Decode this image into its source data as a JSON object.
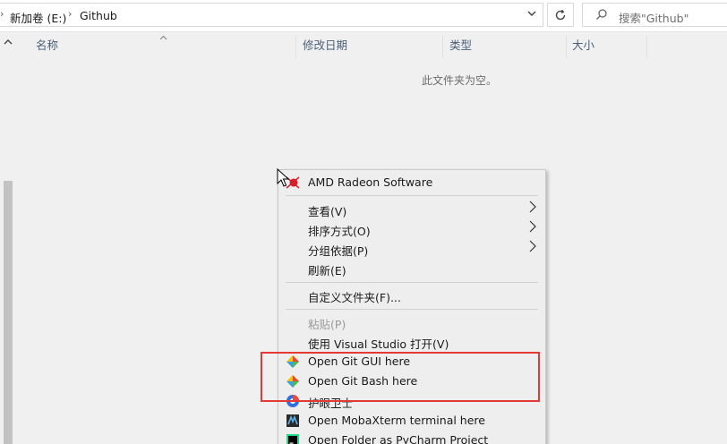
{
  "address": {
    "crumbs": [
      "新加卷 (E:)",
      "Github"
    ]
  },
  "search": {
    "placeholder": "搜索\"Github\""
  },
  "columns": [
    "名称",
    "修改日期",
    "类型",
    "大小"
  ],
  "empty_message": "此文件夹为空。",
  "context_menu": {
    "items": [
      {
        "label": "AMD Radeon Software",
        "icon": "amd-radeon-icon"
      },
      {
        "label": "查看(V)",
        "submenu": true
      },
      {
        "label": "排序方式(O)",
        "submenu": true
      },
      {
        "label": "分组依据(P)",
        "submenu": true
      },
      {
        "label": "刷新(E)"
      },
      {
        "label": "自定义文件夹(F)..."
      },
      {
        "label": "粘贴(P)",
        "disabled": true
      },
      {
        "label": "使用 Visual Studio 打开(V)"
      },
      {
        "label": "Open Git GUI here",
        "icon": "git-icon"
      },
      {
        "label": "Open Git Bash here",
        "icon": "git-icon"
      },
      {
        "label": "护眼卫士",
        "icon": "eye-guard-icon"
      },
      {
        "label": "Open MobaXterm terminal here",
        "icon": "mobaxterm-icon"
      },
      {
        "label": "Open Folder as PyCharm Project",
        "icon": "pycharm-icon"
      }
    ]
  },
  "colors": {
    "highlight": "#e53935",
    "menu_bg": "#eeeeee",
    "header_text": "#4c607a"
  }
}
